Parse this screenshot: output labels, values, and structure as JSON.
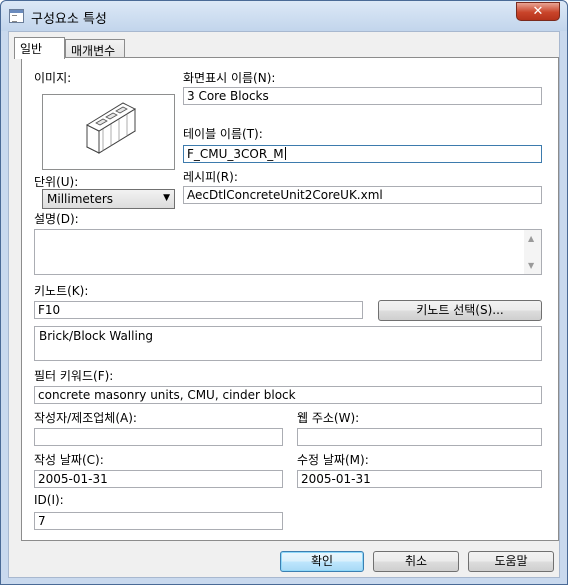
{
  "window": {
    "title": "구성요소 특성",
    "close_label": "✕"
  },
  "tabs": [
    {
      "label": "일반"
    },
    {
      "label": "매개변수"
    }
  ],
  "form": {
    "image_label": "이미지:",
    "display_name_label": "화면표시 이름(N):",
    "display_name_value": "3 Core Blocks",
    "table_name_label": "테이블 이름(T):",
    "table_name_value": "F_CMU_3COR_M",
    "units_label": "단위(U):",
    "units_value": "Millimeters",
    "recipe_label": "레시피(R):",
    "recipe_value": "AecDtlConcreteUnit2CoreUK.xml",
    "description_label": "설명(D):",
    "description_value": "",
    "keynote_label": "키노트(K):",
    "keynote_value": "F10",
    "keynote_select_button": "키노트 선택(S)...",
    "keynote_description": "Brick/Block Walling",
    "filter_keywords_label": "필터 키워드(F):",
    "filter_keywords_value": "concrete masonry units, CMU, cinder block",
    "author_label": "작성자/제조업체(A):",
    "author_value": "",
    "web_label": "웹 주소(W):",
    "web_value": "",
    "created_label": "작성 날짜(C):",
    "created_value": "2005-01-31",
    "modified_label": "수정 날짜(M):",
    "modified_value": "2005-01-31",
    "id_label": "ID(I):",
    "id_value": "7"
  },
  "buttons": {
    "ok": "확인",
    "cancel": "취소",
    "help": "도움말"
  }
}
